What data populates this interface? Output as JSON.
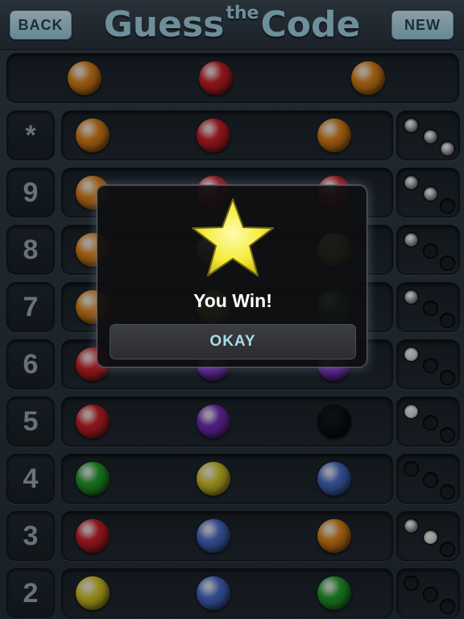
{
  "header": {
    "back_label": "BACK",
    "new_label": "NEW",
    "title_part1": "Guess",
    "title_part2": "the",
    "title_part3": "Code"
  },
  "colors": {
    "orange": "#e98a1a",
    "red": "#d8222a",
    "green": "#27a92e",
    "yellow": "#e2d12a",
    "blue": "#4c73d6",
    "purple": "#7a2fc4",
    "empty": "#090b0d",
    "peg_gray": "#7c848a",
    "peg_white": "#dcdcdc",
    "peg_empty": "#1a2126"
  },
  "secret_code": [
    "orange",
    "red",
    "orange"
  ],
  "rows": [
    {
      "label": "*",
      "guess": [
        "orange",
        "red",
        "orange"
      ],
      "pegs": [
        "peg_gray",
        "peg_gray",
        "peg_gray"
      ]
    },
    {
      "label": "9",
      "guess": [
        "orange",
        "red",
        "red"
      ],
      "pegs": [
        "peg_gray",
        "peg_gray",
        "peg_empty"
      ]
    },
    {
      "label": "8",
      "guess": [
        "orange",
        "orange",
        "yellow"
      ],
      "pegs": [
        "peg_gray",
        "peg_empty",
        "peg_empty"
      ]
    },
    {
      "label": "7",
      "guess": [
        "orange",
        "yellow",
        "green"
      ],
      "pegs": [
        "peg_gray",
        "peg_empty",
        "peg_empty"
      ]
    },
    {
      "label": "6",
      "guess": [
        "red",
        "purple",
        "purple"
      ],
      "pegs": [
        "peg_white",
        "peg_empty",
        "peg_empty"
      ]
    },
    {
      "label": "5",
      "guess": [
        "red",
        "purple",
        "empty"
      ],
      "pegs": [
        "peg_white",
        "peg_empty",
        "peg_empty"
      ]
    },
    {
      "label": "4",
      "guess": [
        "green",
        "yellow",
        "blue"
      ],
      "pegs": [
        "peg_empty",
        "peg_empty",
        "peg_empty"
      ]
    },
    {
      "label": "3",
      "guess": [
        "red",
        "blue",
        "orange"
      ],
      "pegs": [
        "peg_gray",
        "peg_white",
        "peg_empty"
      ]
    },
    {
      "label": "2",
      "guess": [
        "yellow",
        "blue",
        "green"
      ],
      "pegs": [
        "peg_empty",
        "peg_empty",
        "peg_empty"
      ]
    }
  ],
  "dialog": {
    "icon": "star-icon",
    "message": "You Win!",
    "okay_label": "OKAY"
  }
}
